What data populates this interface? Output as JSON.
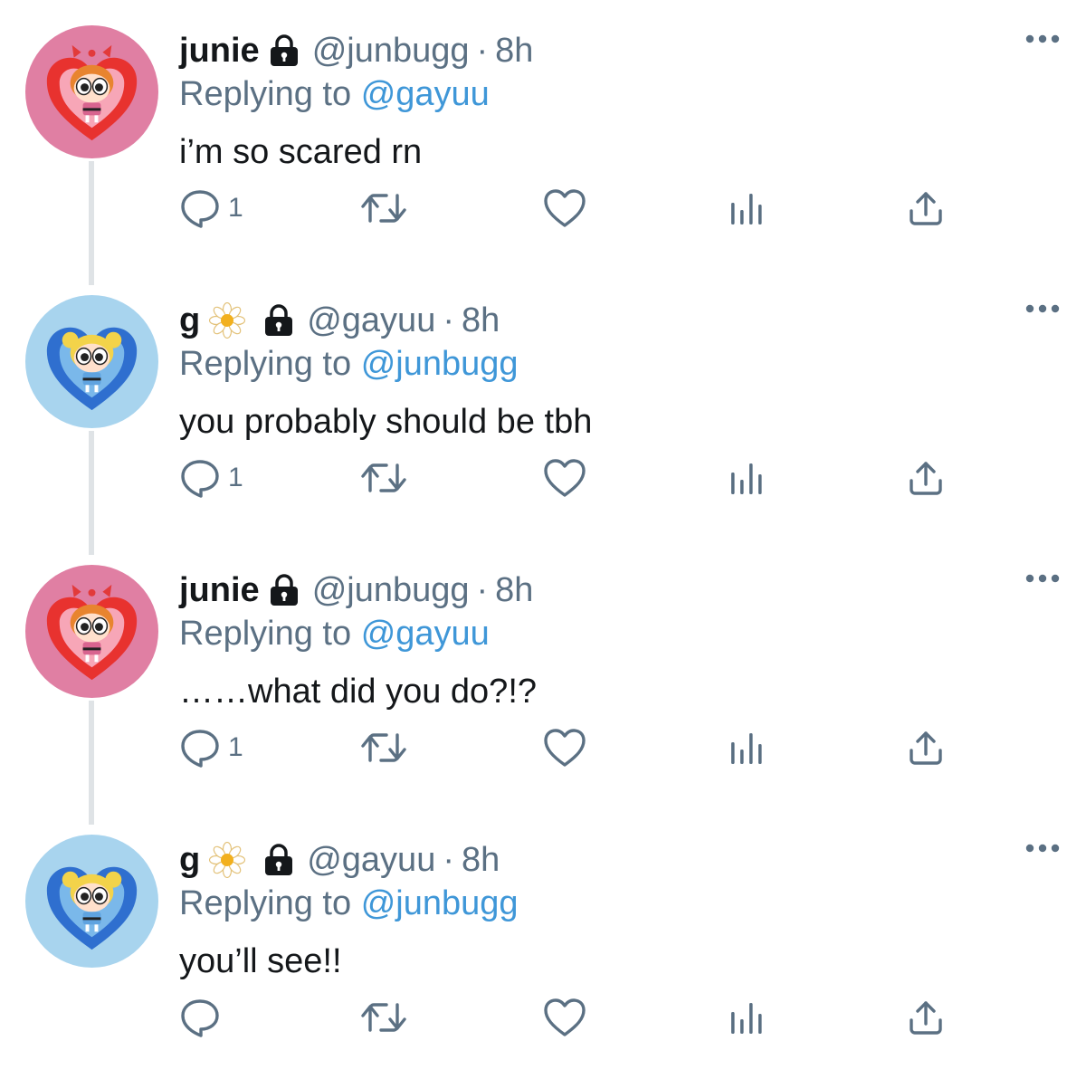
{
  "colors": {
    "link": "#3f97d8",
    "secondary_text": "#5b7083",
    "primary_text": "#14171a",
    "thread_line": "#dfe3e6",
    "avatar_pink": "#e07fa3",
    "avatar_blue": "#a8d4ee",
    "heart_red": "#e8322f",
    "heart_blue": "#2f6fcf"
  },
  "icons": {
    "reply": "comment-bubble-icon",
    "retweet": "retweet-arrows-icon",
    "like": "heart-outline-icon",
    "analytics": "bar-chart-icon",
    "share": "share-upload-icon",
    "more": "ellipsis-icon",
    "protected": "lock-icon",
    "emoji": "daisy-flower-icon"
  },
  "tweets": [
    {
      "name": "junie",
      "handle": "@junbugg",
      "separator": "·",
      "time": "8h",
      "replying_prefix": "Replying to",
      "replying_to": "@gayuu",
      "text": "i’m so scared rn",
      "reply_count": "1",
      "avatar": "blossom-heart",
      "has_flower": false
    },
    {
      "name": "g",
      "handle": "@gayuu",
      "separator": "·",
      "time": "8h",
      "replying_prefix": "Replying to",
      "replying_to": "@junbugg",
      "text": "you probably should be tbh",
      "reply_count": "1",
      "avatar": "bubbles-heart",
      "has_flower": true
    },
    {
      "name": "junie",
      "handle": "@junbugg",
      "separator": "·",
      "time": "8h",
      "replying_prefix": "Replying to",
      "replying_to": "@gayuu",
      "text": "……what did you do?!?",
      "reply_count": "1",
      "avatar": "blossom-heart",
      "has_flower": false
    },
    {
      "name": "g",
      "handle": "@gayuu",
      "separator": "·",
      "time": "8h",
      "replying_prefix": "Replying to",
      "replying_to": "@junbugg",
      "text": "you’ll see!!",
      "reply_count": "",
      "avatar": "bubbles-heart",
      "has_flower": true
    }
  ]
}
